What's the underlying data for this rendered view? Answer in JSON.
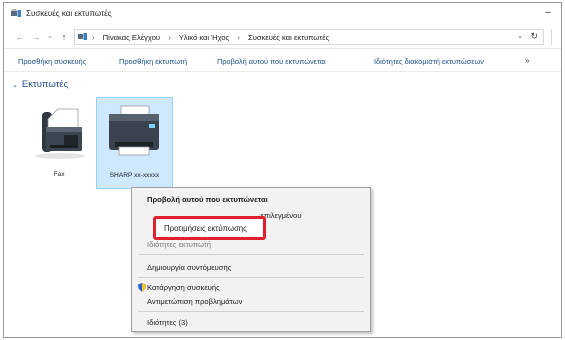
{
  "window": {
    "title": "Συσκευές και εκτυπωτές",
    "minimize_glyph": "–"
  },
  "address": {
    "crumbs": [
      "Πίνακας Ελέγχου",
      "Υλικό και Ήχος",
      "Συσκευές και εκτυπωτές"
    ],
    "separator": "›",
    "back_glyph": "←",
    "forward_glyph": "→",
    "recent_glyph": "⌄",
    "up_glyph": "↑",
    "dropdown_glyph": "⌄",
    "refresh_glyph": "↻"
  },
  "toolbar": {
    "add_device": "Προσθήκη συσκευής",
    "add_printer": "Προσθήκη εκτυπωτή",
    "see_printing": "Προβολή αυτού που εκτυπώνεται",
    "print_server_props": "Ιδιότητες διακομιστή εκτυπώσεων",
    "more": "»"
  },
  "group": {
    "title": "Εκτυπωτές",
    "chevron": "⌄"
  },
  "devices": [
    {
      "label": "Fax"
    },
    {
      "label": "SHARP xx-xxxxx"
    }
  ],
  "context_menu": {
    "see_printing": "Προβολή αυτού που εκτυπώνεται",
    "set_default_partial": "...επιλεγμένου",
    "printing_preferences": "Προτιμήσεις εκτύπωσης",
    "printer_properties": "Ιδιότητες εκτυπωτή",
    "create_shortcut": "Δημιουργία συντόμευσης",
    "remove_device": "Κατάργηση συσκευής",
    "troubleshoot": "Αντιμετώπιση προβλημάτων",
    "properties": "Ιδιότητες (3)"
  },
  "colors": {
    "selection_fill": "#cde8ff",
    "highlight_border": "#e0202f",
    "link_blue": "#1f4e8f"
  }
}
